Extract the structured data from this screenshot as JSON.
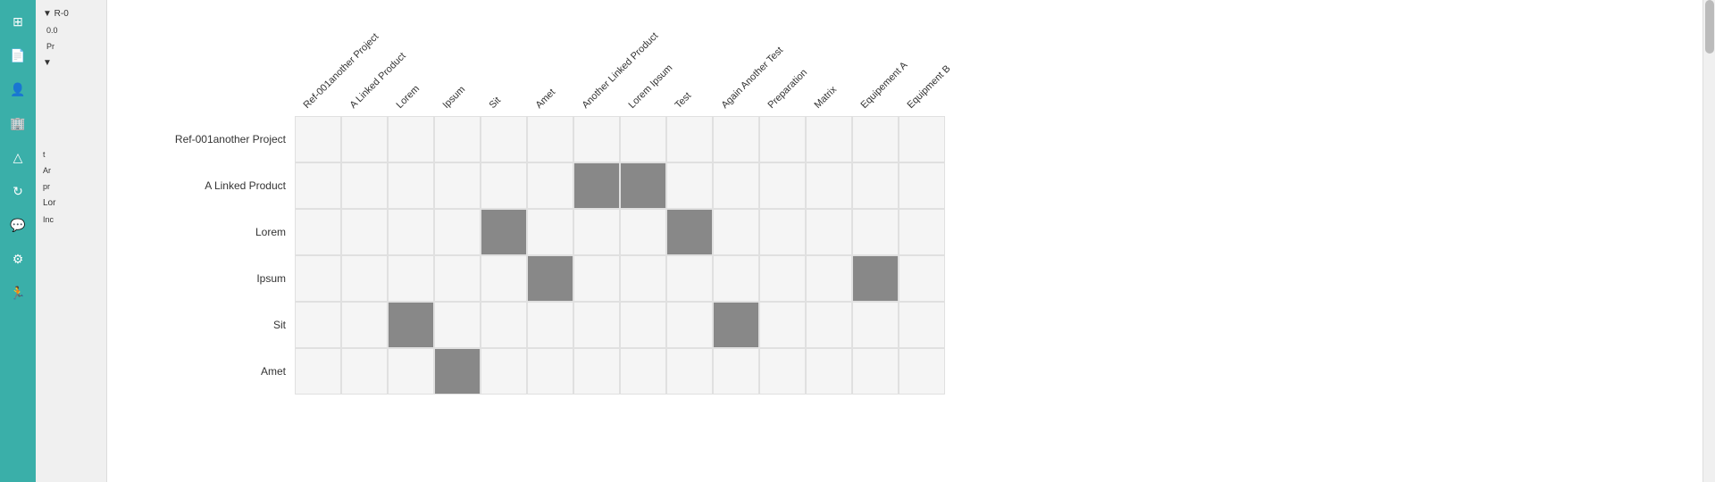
{
  "sidebar": {
    "icons": [
      {
        "name": "grid-icon",
        "symbol": "⊞"
      },
      {
        "name": "file-icon",
        "symbol": "📄"
      },
      {
        "name": "user-icon",
        "symbol": "👤"
      },
      {
        "name": "building-icon",
        "symbol": "🏢"
      },
      {
        "name": "hierarchy-icon",
        "symbol": "⑃"
      },
      {
        "name": "refresh-icon",
        "symbol": "↻"
      },
      {
        "name": "chat-icon",
        "symbol": "💬"
      },
      {
        "name": "settings-icon",
        "symbol": "⚙"
      },
      {
        "name": "person-icon",
        "symbol": "🏃"
      }
    ]
  },
  "leftPanel": {
    "items": [
      {
        "label": "R-0",
        "sub": "0.0",
        "desc": "Pr"
      },
      {
        "label": "t",
        "sub": "Ar",
        "desc": "pr"
      },
      {
        "label": "Lor"
      },
      {
        "label": "Inc"
      }
    ]
  },
  "matrix": {
    "columnHeaders": [
      "Ref-001another Project",
      "A Linked Product",
      "Lorem",
      "Ipsum",
      "Sit",
      "Amet",
      "Another Linked Product",
      "Lorem Ipsum",
      "Test",
      "Again Another Test",
      "Preparation",
      "Matrix",
      "Equipement A",
      "Equipment B"
    ],
    "rows": [
      {
        "label": "Ref-001another Project",
        "cells": [
          0,
          0,
          0,
          0,
          0,
          0,
          0,
          0,
          0,
          0,
          0,
          0,
          0,
          0
        ]
      },
      {
        "label": "A Linked Product",
        "cells": [
          0,
          0,
          0,
          0,
          0,
          0,
          1,
          1,
          0,
          0,
          0,
          0,
          0,
          0
        ]
      },
      {
        "label": "Lorem",
        "cells": [
          0,
          0,
          0,
          0,
          1,
          0,
          0,
          0,
          1,
          0,
          0,
          0,
          0,
          0
        ]
      },
      {
        "label": "Ipsum",
        "cells": [
          0,
          0,
          0,
          0,
          0,
          1,
          0,
          0,
          0,
          0,
          0,
          0,
          1,
          0
        ]
      },
      {
        "label": "Sit",
        "cells": [
          0,
          0,
          1,
          0,
          0,
          0,
          0,
          0,
          0,
          1,
          0,
          0,
          0,
          0
        ]
      },
      {
        "label": "Amet",
        "cells": [
          0,
          0,
          0,
          1,
          0,
          0,
          0,
          0,
          0,
          0,
          0,
          0,
          0,
          0
        ]
      }
    ]
  }
}
